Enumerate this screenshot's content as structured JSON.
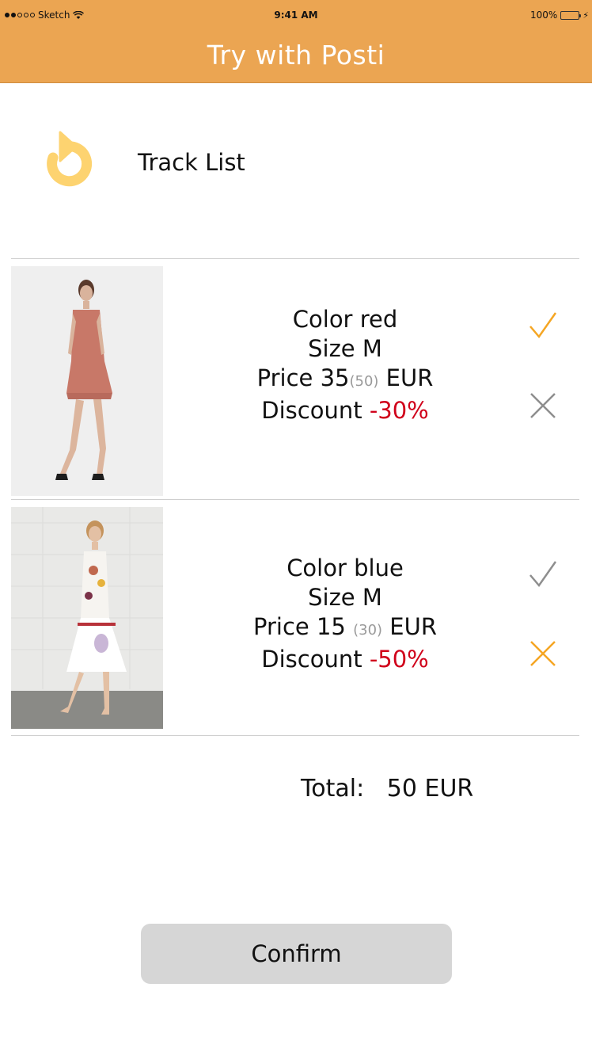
{
  "status_bar": {
    "carrier": "Sketch",
    "time": "9:41 AM",
    "battery": "100%"
  },
  "navbar": {
    "title": "Try with Posti"
  },
  "header": {
    "title": "Track List",
    "refresh_icon": "refresh-icon"
  },
  "items": [
    {
      "color_label": "Color red",
      "size_label": "Size M",
      "price_prefix": "Price 35",
      "price_original": "(50)",
      "price_currency": "EUR",
      "discount_prefix": "Discount",
      "discount_value": "-30%",
      "accepted": true
    },
    {
      "color_label": "Color blue",
      "size_label": "Size M",
      "price_prefix": "Price 15",
      "price_original": "(30)",
      "price_currency": "EUR",
      "discount_prefix": "Discount",
      "discount_value": "-50%",
      "accepted": false
    }
  ],
  "total": {
    "label": "Total:",
    "value": "50 EUR"
  },
  "confirm_label": "Confirm",
  "colors": {
    "accent": "#eba552",
    "active_icon": "#f5a623",
    "inactive_icon": "#8e8e8e",
    "discount": "#d0021b"
  }
}
